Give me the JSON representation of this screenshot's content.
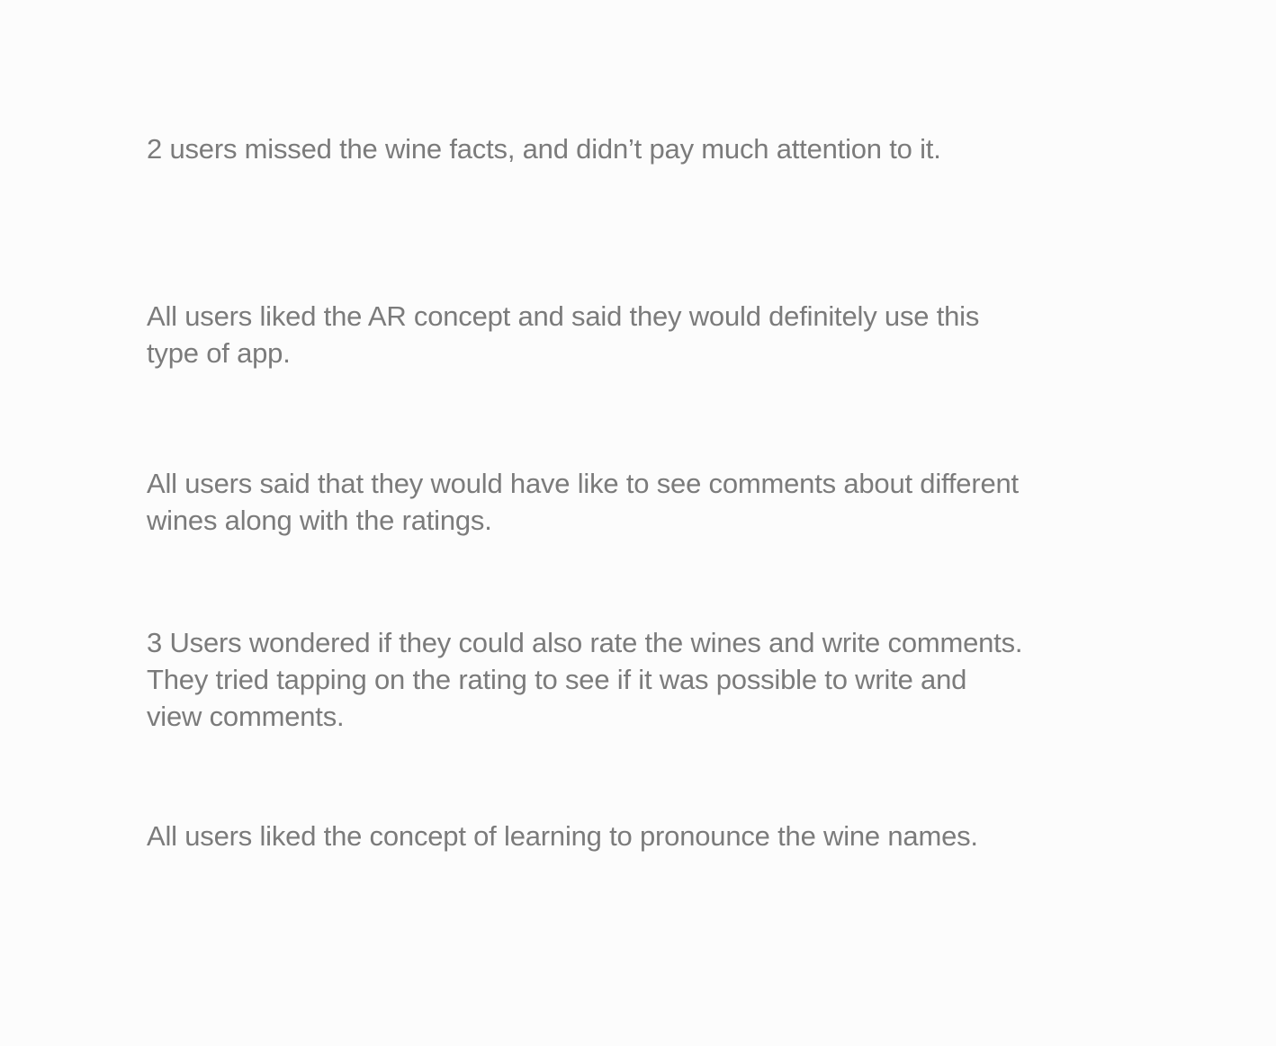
{
  "findings": [
    {
      "text": "2 users missed the wine facts, and didn’t pay much attention to it."
    },
    {
      "text": "All users liked the AR concept and said they would definitely use this type of app."
    },
    {
      "text": "All users said that they would have like to see comments about different wines along with the ratings."
    },
    {
      "text": "3 Users wondered if they could also rate the wines and write comments. They tried tapping on the rating to see if it was possible to write and view comments."
    },
    {
      "text": "All users liked the concept of learning to pronounce the wine names."
    }
  ],
  "colors": {
    "background": "#fcfcfc",
    "text": "#7b7b7b"
  }
}
